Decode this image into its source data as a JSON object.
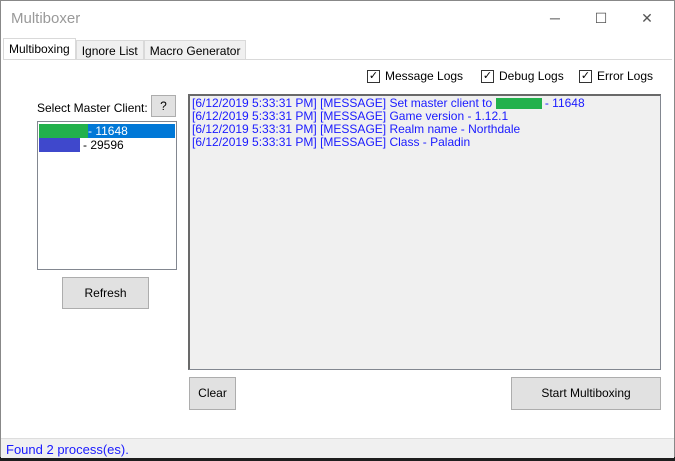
{
  "window": {
    "title": "Multiboxer",
    "minimize": "─",
    "maximize": "☐",
    "close": "✕"
  },
  "tabs": [
    "Multiboxing",
    "Ignore List",
    "Macro Generator"
  ],
  "checkboxes": [
    {
      "label": "Message Logs",
      "checked": true
    },
    {
      "label": "Debug Logs",
      "checked": true
    },
    {
      "label": "Error Logs",
      "checked": true
    }
  ],
  "master": {
    "label": "Select Master Client:",
    "help": "?",
    "clients": [
      {
        "pid": "- 11648",
        "color": "#22b14c",
        "selected": true
      },
      {
        "pid": "- 29596",
        "color": "#3f48cc",
        "selected": false
      }
    ],
    "refresh": "Refresh"
  },
  "logs": [
    {
      "pre": "[6/12/2019 5:33:31 PM] [MESSAGE] Set master client to",
      "post": "- 11648"
    },
    {
      "pre": "[6/12/2019 5:33:31 PM] [MESSAGE] Game version - 1.12.1"
    },
    {
      "pre": "[6/12/2019 5:33:31 PM] [MESSAGE] Realm name - Northdale"
    },
    {
      "pre": "[6/12/2019 5:33:31 PM] [MESSAGE] Class - Paladin"
    }
  ],
  "buttons": {
    "clear": "Clear",
    "start": "Start Multiboxing"
  },
  "status": "Found 2 process(es)."
}
